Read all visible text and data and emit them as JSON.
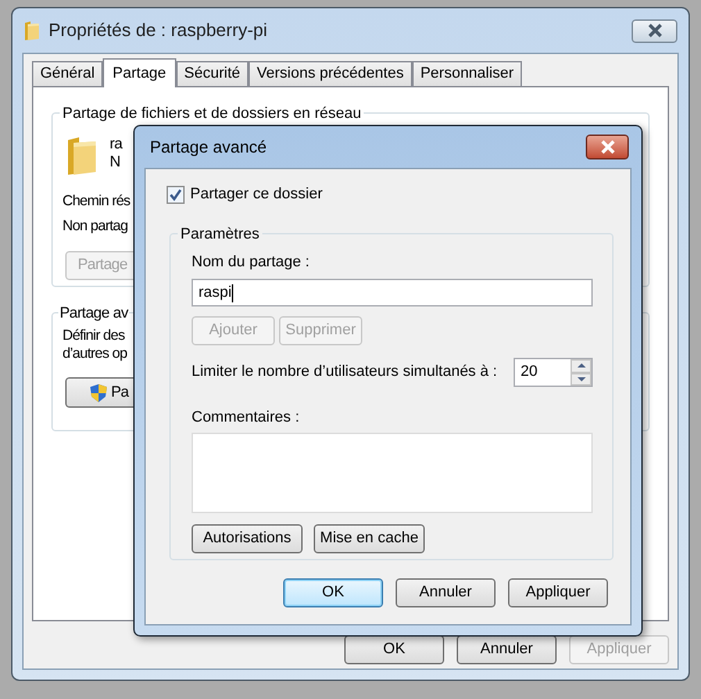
{
  "window": {
    "title": "Propriétés de : raspberry-pi"
  },
  "tabs": [
    {
      "label": "Général",
      "selected": false
    },
    {
      "label": "Partage",
      "selected": true
    },
    {
      "label": "Sécurité",
      "selected": false
    },
    {
      "label": "Versions précédentes",
      "selected": false
    },
    {
      "label": "Personnaliser",
      "selected": false
    }
  ],
  "network_sharing": {
    "title": "Partage de fichiers et de dossiers en réseau",
    "name": "ra",
    "status": "N",
    "path_label": "Chemin rés",
    "state": "Non partag",
    "button": {
      "label": "Partage",
      "disabled": true
    }
  },
  "advanced_sharing": {
    "title": "Partage av",
    "description": [
      "Définir des",
      "d’autres op"
    ],
    "button": {
      "label": "Pa",
      "disabled": false
    }
  },
  "buttons": [
    {
      "label": "OK",
      "disabled": false
    },
    {
      "label": "Annuler",
      "disabled": false
    },
    {
      "label": "Appliquer",
      "disabled": true
    }
  ],
  "dialog": {
    "title": "Partage avancé",
    "share_checkbox": {
      "label": "Partager ce dossier",
      "checked": true
    },
    "settings": {
      "title": "Paramètres",
      "share_name_label": "Nom du partage :",
      "share_name": "raspi",
      "name_buttons": [
        {
          "label": "Ajouter",
          "disabled": true
        },
        {
          "label": "Supprimer",
          "disabled": true
        }
      ],
      "limit_label": "Limiter le nombre d’utilisateurs simultanés à :",
      "limit_value": "20",
      "comments_label": "Commentaires :",
      "action_buttons": [
        {
          "label": "Autorisations",
          "disabled": false
        },
        {
          "label": "Mise en cache",
          "disabled": false
        }
      ]
    },
    "buttons": [
      {
        "label": "OK",
        "default": true
      },
      {
        "label": "Annuler",
        "default": false
      },
      {
        "label": "Appliquer",
        "default": false
      }
    ]
  }
}
